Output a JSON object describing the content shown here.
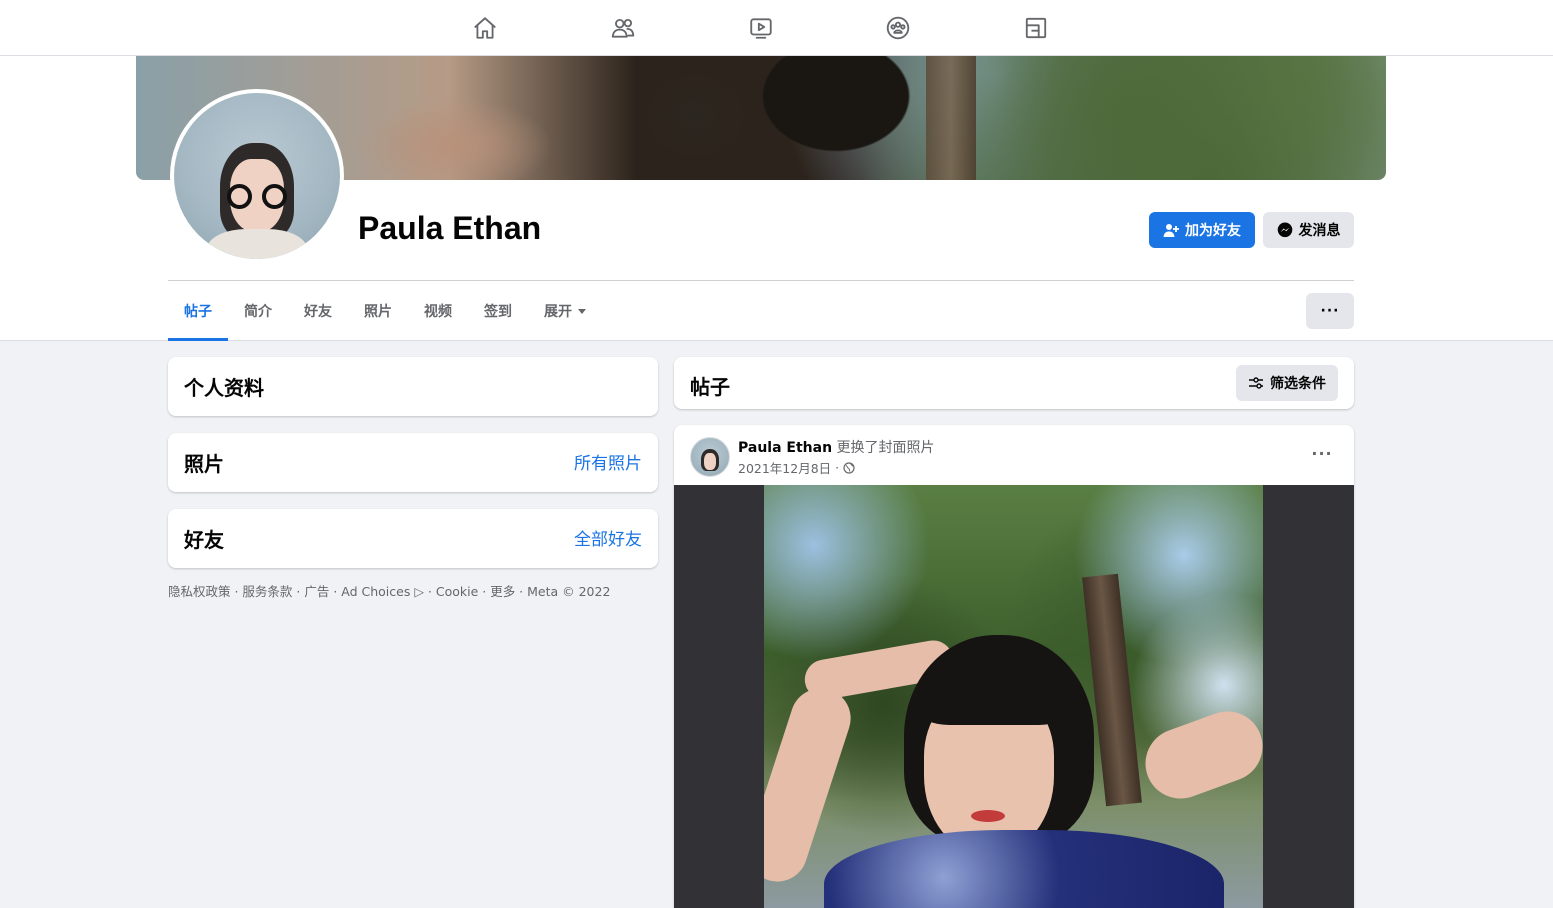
{
  "topnav": {
    "items": [
      {
        "name": "home",
        "icon": "home-icon"
      },
      {
        "name": "friends",
        "icon": "friends-icon"
      },
      {
        "name": "watch",
        "icon": "video-icon"
      },
      {
        "name": "groups",
        "icon": "groups-icon"
      },
      {
        "name": "gaming",
        "icon": "gaming-icon"
      }
    ]
  },
  "profile": {
    "name": "Paula Ethan",
    "add_friend_label": "加为好友",
    "message_label": "发消息"
  },
  "tabs": [
    {
      "label": "帖子",
      "active": true
    },
    {
      "label": "简介"
    },
    {
      "label": "好友"
    },
    {
      "label": "照片"
    },
    {
      "label": "视频"
    },
    {
      "label": "签到"
    },
    {
      "label": "展开"
    }
  ],
  "more_button": "···",
  "left": {
    "intro_title": "个人资料",
    "photos_title": "照片",
    "photos_link": "所有照片",
    "friends_title": "好友",
    "friends_link": "全部好友",
    "footer": "隐私权政策 · 服务条款 · 广告 · Ad Choices ▷ · Cookie · 更多 · Meta © 2022"
  },
  "posts": {
    "title": "帖子",
    "filter_label": "筛选条件",
    "post": {
      "author": "Paula Ethan",
      "action": "更换了封面照片",
      "date": "2021年12月8日",
      "separator": "·",
      "menu": "···"
    }
  },
  "colors": {
    "accent": "#1b74e4",
    "background": "#f0f2f5",
    "secondary_button": "#e4e6eb"
  }
}
